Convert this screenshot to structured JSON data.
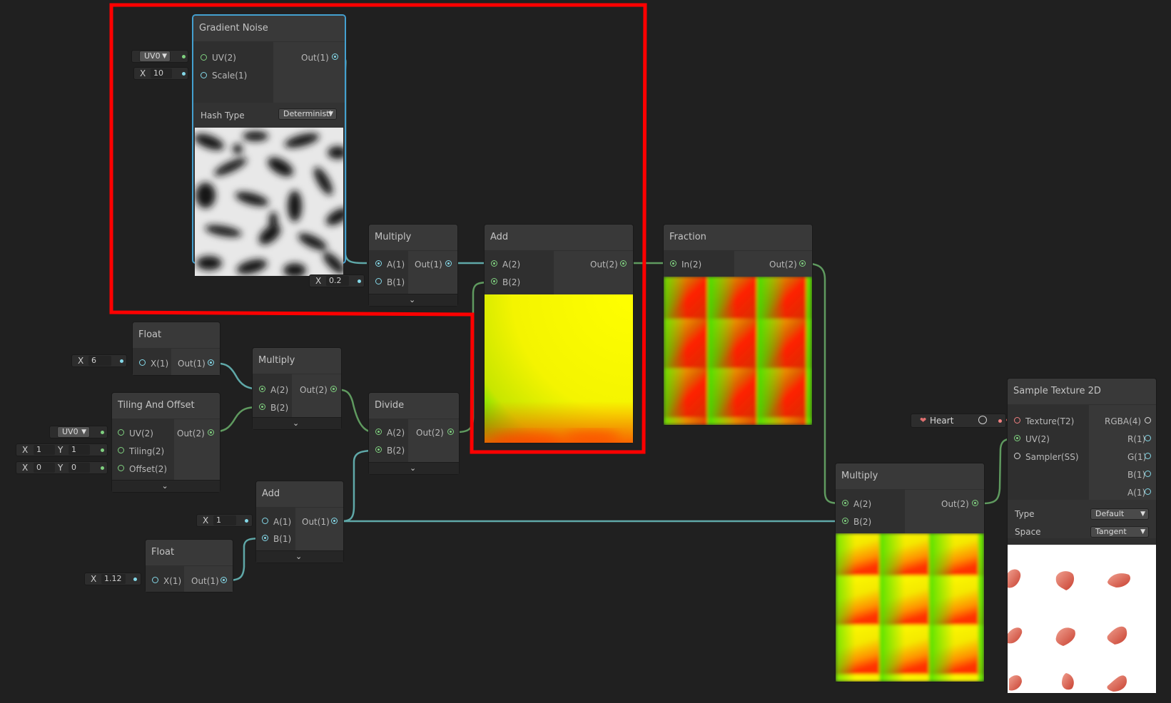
{
  "nodes": {
    "gradient_noise": {
      "title": "Gradient Noise",
      "inputs": [
        "UV(2)",
        "Scale(1)"
      ],
      "output": "Out(1)",
      "uv_channel": "UV0",
      "scale_axis": "X",
      "scale_value": "10",
      "hash_type_label": "Hash Type",
      "hash_type_value": "Deterministi"
    },
    "multiply_top": {
      "title": "Multiply",
      "inputs": [
        "A(1)",
        "B(1)"
      ],
      "output": "Out(1)",
      "b_axis": "X",
      "b_value": "0.2"
    },
    "add_top": {
      "title": "Add",
      "inputs": [
        "A(2)",
        "B(2)"
      ],
      "output": "Out(2)"
    },
    "fraction": {
      "title": "Fraction",
      "input": "In(2)",
      "output": "Out(2)"
    },
    "float_top": {
      "title": "Float",
      "input": "X(1)",
      "output": "Out(1)",
      "axis": "X",
      "value": "6"
    },
    "multiply_mid": {
      "title": "Multiply",
      "inputs": [
        "A(2)",
        "B(2)"
      ],
      "output": "Out(2)"
    },
    "tiling_offset": {
      "title": "Tiling And Offset",
      "inputs": [
        "UV(2)",
        "Tiling(2)",
        "Offset(2)"
      ],
      "output": "Out(2)",
      "uv_channel": "UV0",
      "tiling": {
        "x_label": "X",
        "x": "1",
        "y_label": "Y",
        "y": "1"
      },
      "offset": {
        "x_label": "X",
        "x": "0",
        "y_label": "Y",
        "y": "0"
      }
    },
    "divide": {
      "title": "Divide",
      "inputs": [
        "A(2)",
        "B(2)"
      ],
      "output": "Out(2)"
    },
    "add_bottom": {
      "title": "Add",
      "inputs": [
        "A(1)",
        "B(1)"
      ],
      "output": "Out(1)",
      "a_axis": "X",
      "a_value": "1"
    },
    "float_bottom": {
      "title": "Float",
      "input": "X(1)",
      "output": "Out(1)",
      "axis": "X",
      "value": "1.12"
    },
    "multiply_bottom": {
      "title": "Multiply",
      "inputs": [
        "A(2)",
        "B(2)"
      ],
      "output": "Out(2)"
    },
    "sample_texture": {
      "title": "Sample Texture 2D",
      "inputs": [
        "Texture(T2)",
        "UV(2)",
        "Sampler(SS)"
      ],
      "outputs": [
        "RGBA(4)",
        "R(1)",
        "G(1)",
        "B(1)",
        "A(1)"
      ],
      "texture_value": "Heart",
      "type_label": "Type",
      "type_value": "Default",
      "space_label": "Space",
      "space_value": "Tangent"
    }
  },
  "colors": {
    "background": "#202020",
    "node_body": "#2f2f2f",
    "node_header": "#393939",
    "wire_float": "#5fa8a8",
    "wire_vector2": "#5f9a5f",
    "wire_texture": "#d06060",
    "selection": "#44a0d0",
    "highlight_box": "#ff0000"
  }
}
